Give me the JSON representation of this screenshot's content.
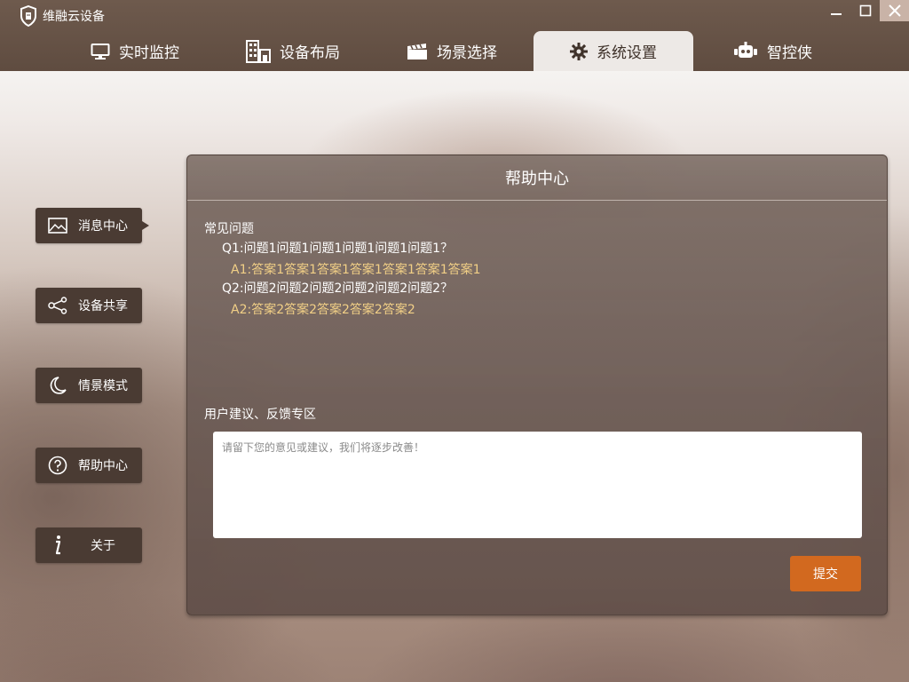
{
  "app": {
    "title": "维融云设备"
  },
  "window_controls": {
    "minimize_icon": "minimize-icon",
    "maximize_icon": "maximize-icon",
    "close_icon": "close-icon"
  },
  "nav": {
    "tabs": [
      {
        "label": "实时监控",
        "icon": "monitor-icon",
        "active": false
      },
      {
        "label": "设备布局",
        "icon": "building-icon",
        "active": false
      },
      {
        "label": "场景选择",
        "icon": "clapperboard-icon",
        "active": false
      },
      {
        "label": "系统设置",
        "icon": "gear-icon",
        "active": true
      },
      {
        "label": "智控侠",
        "icon": "robot-icon",
        "active": false
      }
    ]
  },
  "sidebar": {
    "items": [
      {
        "label": "消息中心",
        "icon": "image-icon",
        "active": true
      },
      {
        "label": "设备共享",
        "icon": "share-icon",
        "active": false
      },
      {
        "label": "情景模式",
        "icon": "moon-icon",
        "active": false
      },
      {
        "label": "帮助中心",
        "icon": "question-icon",
        "active": false
      },
      {
        "label": "关于",
        "icon": "info-icon",
        "active": false
      }
    ]
  },
  "panel": {
    "title": "帮助中心",
    "faq": {
      "title": "常见问题",
      "items": [
        {
          "q": "Q1:问题1问题1问题1问题1问题1问题1？",
          "a": "A1:答案1答案1答案1答案1答案1答案1答案1"
        },
        {
          "q": "Q2:问题2问题2问题2问题2问题2问题2？",
          "a": "A2:答案2答案2答案2答案2答案2"
        }
      ]
    },
    "feedback": {
      "title": "用户建议、反馈专区",
      "placeholder": "请留下您的意见或建议，我们将逐步改善！",
      "value": "",
      "submit_label": "提交"
    }
  },
  "colors": {
    "accent": "#d2691f",
    "answer": "#f1cf86",
    "nav_bg": "#5f4c40",
    "side_btn": "#4a3b33"
  }
}
